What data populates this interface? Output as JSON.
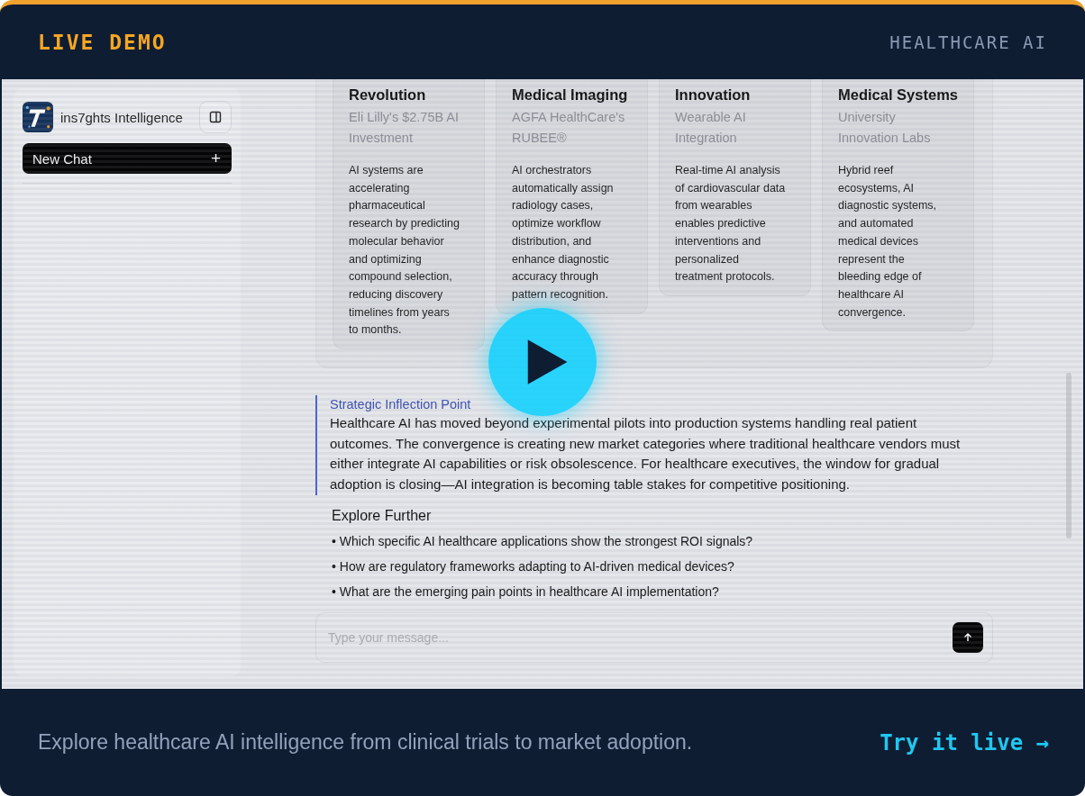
{
  "header": {
    "badge": "LIVE DEMO",
    "topic": "HEALTHCARE AI"
  },
  "sidebar": {
    "brand": "ins7ghts Intelligence",
    "new_chat": "New Chat",
    "new_chat_icon": "+"
  },
  "cards": [
    {
      "title": "Revolution",
      "source": "Eli Lilly's $2.75B AI Investment",
      "body": "AI systems are accelerating pharmaceutical research by predicting molecular behavior and optimizing compound selection, reducing discovery timelines from years to months."
    },
    {
      "title": "Medical Imaging",
      "source": "AGFA HealthCare's RUBEE®",
      "body": "AI orchestrators automatically assign radiology cases, optimize workflow distribution, and enhance diagnostic accuracy through pattern recognition."
    },
    {
      "title": "Innovation",
      "source": "Wearable AI Integration",
      "body": "Real-time AI analysis of cardiovascular data from wearables enables predictive interventions and personalized treatment protocols."
    },
    {
      "title": "Medical Systems",
      "source": "University Innovation Labs",
      "body": "Hybrid reef ecosystems, AI diagnostic systems, and automated medical devices represent the bleeding edge of healthcare AI convergence."
    }
  ],
  "insight": {
    "title": "Strategic Inflection Point",
    "text": "Healthcare AI has moved beyond experimental pilots into production systems handling real patient outcomes. The convergence is creating new market categories where traditional healthcare vendors must either integrate AI capabilities or risk obsolescence. For healthcare executives, the window for gradual adoption is closing—AI integration is becoming table stakes for competitive positioning."
  },
  "explore": {
    "title": "Explore Further",
    "items": [
      "• Which specific AI healthcare applications show the strongest ROI signals?",
      "• How are regulatory frameworks adapting to AI-driven medical devices?",
      "• What are the emerging pain points in healthcare AI implementation?"
    ]
  },
  "composer": {
    "placeholder": "Type your message..."
  },
  "footer": {
    "text": "Explore healthcare AI intelligence from clinical trials to market adoption.",
    "link": "Try it live →"
  }
}
